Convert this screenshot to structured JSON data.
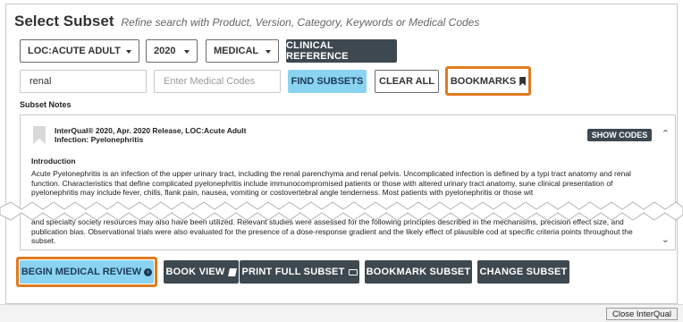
{
  "header": {
    "title": "Select Subset",
    "subtitle": "Refine search with Product, Version, Category, Keywords or Medical Codes"
  },
  "filters": {
    "product": "LOC:ACUTE ADULT",
    "version": "2020",
    "category": "MEDICAL",
    "clinical_reference_label": "CLINICAL REFERENCE"
  },
  "search": {
    "keyword_value": "renal",
    "medical_codes_placeholder": "Enter Medical Codes",
    "find_label": "FIND SUBSETS",
    "clear_label": "CLEAR ALL",
    "bookmarks_label": "BOOKMARKS"
  },
  "notes": {
    "label": "Subset Notes",
    "heading_line1": "InterQual® 2020, Apr. 2020 Release, LOC:Acute Adult",
    "heading_line2": "Infection: Pyelonephritis",
    "show_codes_label": "SHOW CODES",
    "intro_title": "Introduction",
    "paragraph1": "Acute Pyelonephritis is an infection of the upper urinary tract, including the renal parenchyma and renal pelvis. Uncomplicated infection is defined by a typi tract anatomy and renal function. Characteristics that define complicated pyelonephritis include immunocompromised patients or those with altered urinary tract anatomy, sune clinical presentation of pyelonephritis may include fever, chills, flank pain, nausea, vomiting or costovertebral angle tenderness. Most patients with pyelonephritis or those wit",
    "paragraph2": "and specialty society resources may also have been utilized. Relevant studies were assessed for the following principles described in the mechanisms, precision effect size, and publication bias. Observational trials were also evaluated for the presence of a dose-response gradient and the likely effect of plausible cod at specific criteria points throughout the subset."
  },
  "actions": {
    "begin_review_label": "BEGIN MEDICAL REVIEW",
    "book_view_label": "BOOK VIEW",
    "print_label": "PRINT FULL SUBSET",
    "bookmark_subset_label": "BOOKMARK SUBSET",
    "change_subset_label": "CHANGE SUBSET"
  },
  "footer": {
    "close_label": "Close InterQual"
  },
  "colors": {
    "accent_dark": "#3d4850",
    "accent_blue": "#8ad4f2",
    "highlight_orange": "#e07b1f"
  }
}
